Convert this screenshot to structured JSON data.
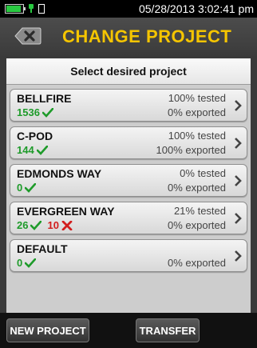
{
  "status_bar": {
    "datetime": "05/28/2013 3:02:41 pm"
  },
  "header": {
    "title": "CHANGE PROJECT"
  },
  "panel": {
    "heading": "Select desired project"
  },
  "projects": [
    {
      "name": "BELLFIRE",
      "tested": "100% tested",
      "exported": "0% exported",
      "pass": "1536",
      "fail": ""
    },
    {
      "name": "C-POD",
      "tested": "100% tested",
      "exported": "100% exported",
      "pass": "144",
      "fail": ""
    },
    {
      "name": "EDMONDS WAY",
      "tested": "0% tested",
      "exported": "0% exported",
      "pass": "0",
      "fail": ""
    },
    {
      "name": "EVERGREEN WAY",
      "tested": "21% tested",
      "exported": "0% exported",
      "pass": "26",
      "fail": "10"
    },
    {
      "name": "DEFAULT",
      "tested": "",
      "exported": "0% exported",
      "pass": "0",
      "fail": ""
    }
  ],
  "buttons": {
    "new_project": "NEW PROJECT",
    "transfer": "TRANSFER"
  },
  "colors": {
    "title": "#f5c500",
    "pass": "#1e9b2a",
    "fail": "#d21d1d",
    "battery": "#29c941"
  }
}
